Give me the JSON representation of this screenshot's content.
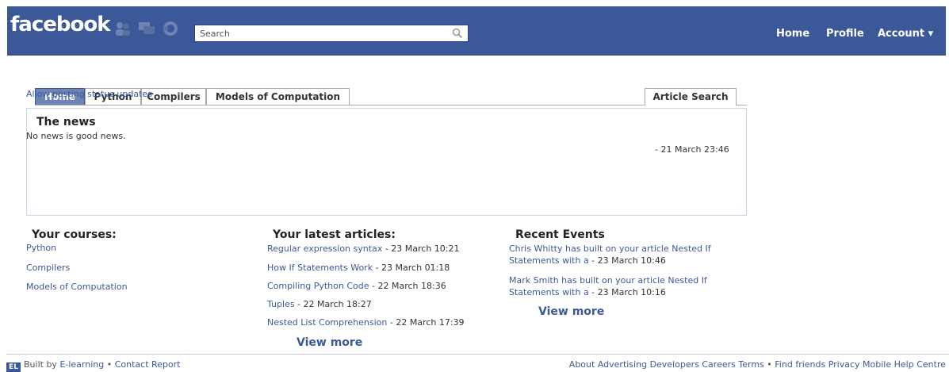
{
  "header": {
    "logo": "facebook",
    "search_placeholder": "Search",
    "nav": [
      "Home",
      "Profile",
      "Account ▾"
    ]
  },
  "tabs": [
    "Home",
    "Python",
    "Compilers",
    "Models of Computation"
  ],
  "article_search": "Article Search",
  "status_updates": "Allow posting status updates",
  "news": {
    "title": "The news",
    "text": "No news is good news.",
    "date": "- 21 March 23:46"
  },
  "courses": {
    "title": "Your courses:",
    "items": [
      "Python",
      "Compilers",
      "Models of Computation"
    ]
  },
  "articles": {
    "title": "Your latest articles:",
    "items": [
      {
        "name": "Regular expression syntax",
        "date": " - 23 March 10:21"
      },
      {
        "name": "How If Statements Work",
        "date": " - 23 March 01:18"
      },
      {
        "name": "Compiling Python Code",
        "date": " - 22 March 18:36"
      },
      {
        "name": "Tuples",
        "date": " - 22 March 18:27"
      },
      {
        "name": "Nested List Comprehension",
        "date": " - 22 March 17:39"
      }
    ],
    "view_more": "View more"
  },
  "events": {
    "title": "Recent Events",
    "items": [
      {
        "text": "Chris Whitty has built on your article Nested If Statements with a",
        "date": " - 23 March 10:46"
      },
      {
        "text": "Mark Smith has built on your article Nested If Statements with a",
        "date": " - 23 March 10:16"
      }
    ],
    "view_more": "View more"
  },
  "footer": {
    "icon": "EL",
    "built_by": "Built by",
    "left_links": [
      "E-learning",
      "Contact",
      "Report"
    ],
    "right_links": [
      "About",
      "Advertising",
      "Developers",
      "Careers",
      "Terms",
      "Find friends",
      "Privacy",
      "Mobile",
      "Help Centre"
    ]
  },
  "colors": {
    "brand_blue": "#3b5998",
    "tab_active": "#6d84b4",
    "link": "#3b5998"
  },
  "icons": [
    "friends-icon",
    "messages-icon",
    "notifications-icon",
    "search-icon"
  ]
}
